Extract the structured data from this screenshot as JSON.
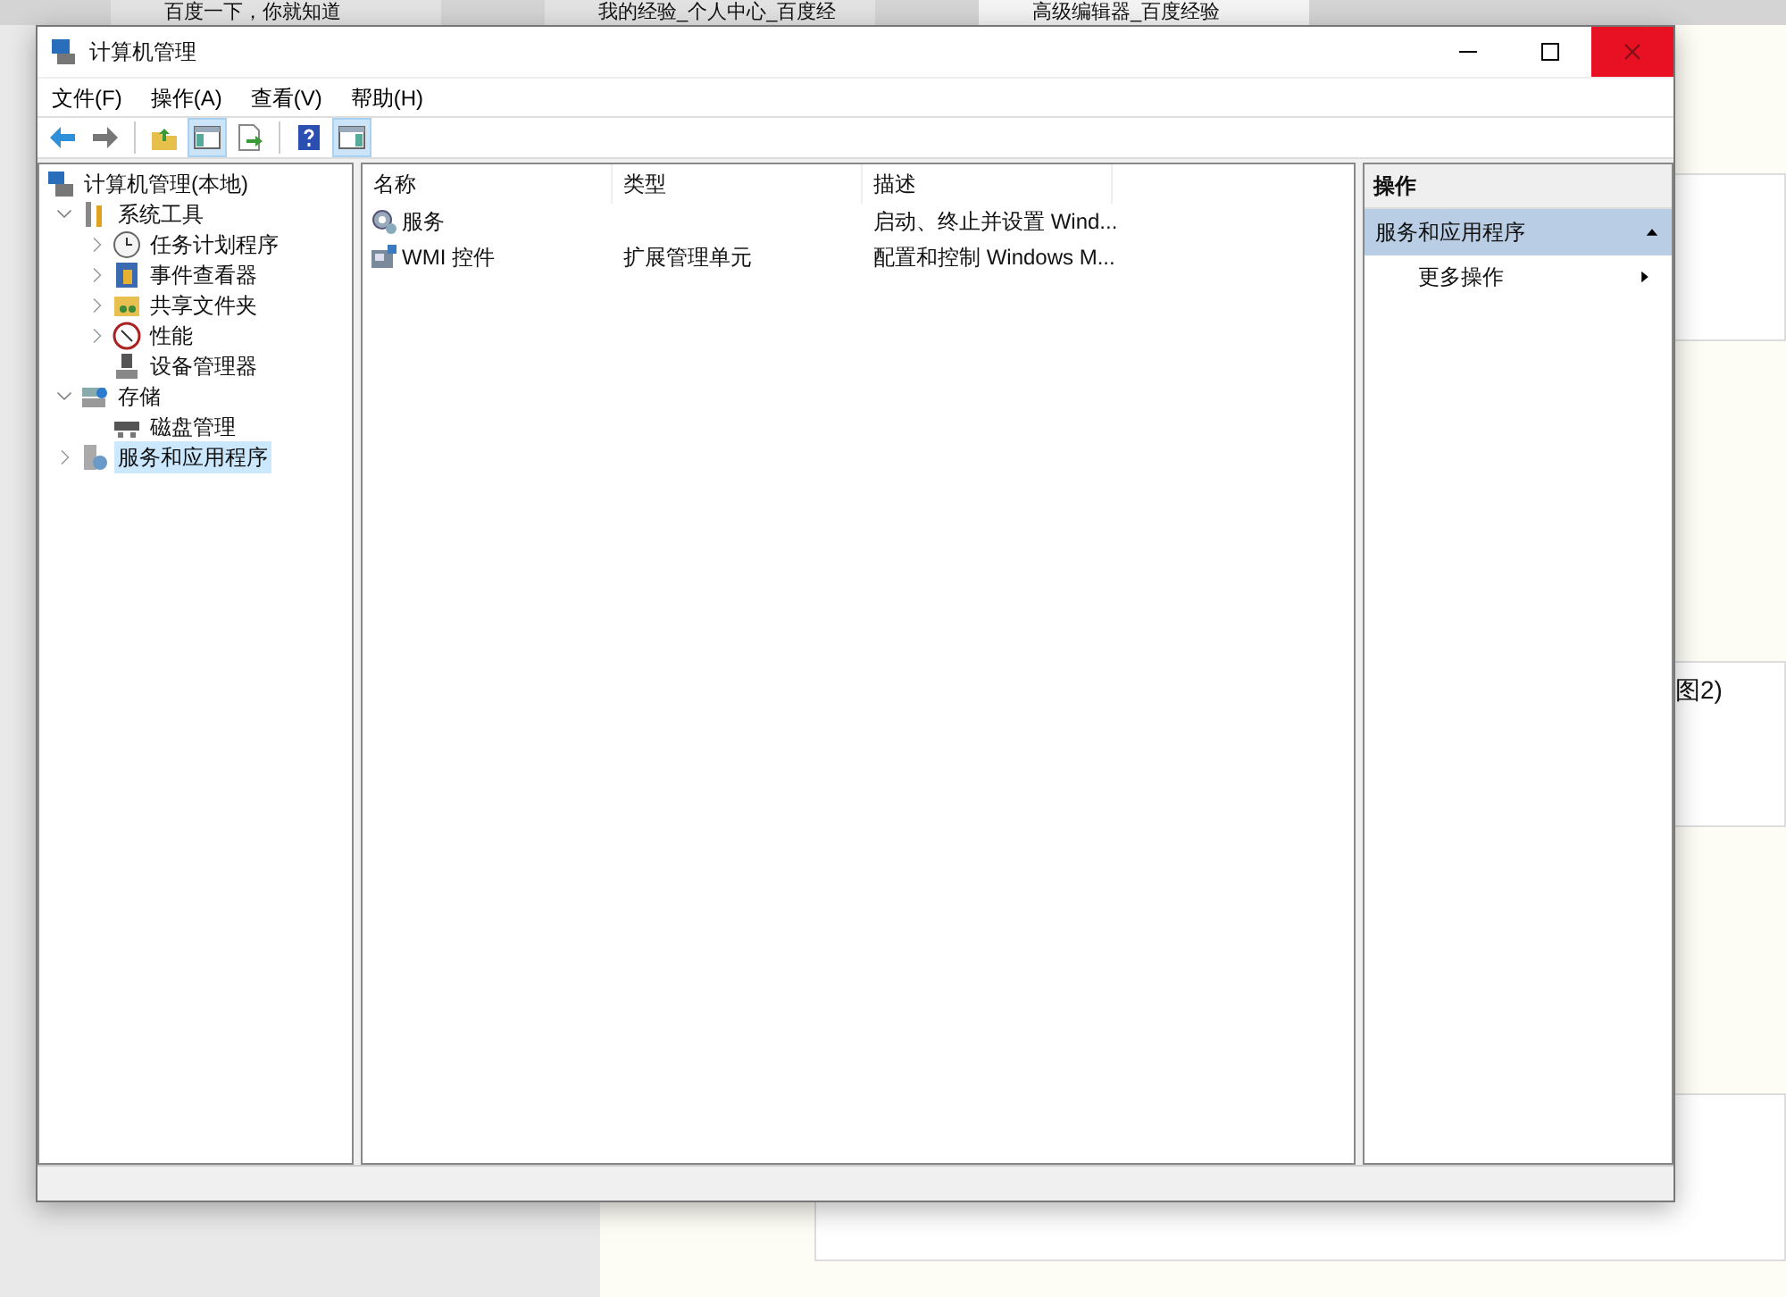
{
  "browser_tabs": [
    {
      "title": "百度一下，你就知道",
      "selected": false
    },
    {
      "title": "我的经验_个人中心_百度经",
      "selected": false
    },
    {
      "title": "高级编辑器_百度经验",
      "selected": true
    }
  ],
  "background_page": {
    "caption": "图2)"
  },
  "window": {
    "title": "计算机管理"
  },
  "menu": [
    "文件(F)",
    "操作(A)",
    "查看(V)",
    "帮助(H)"
  ],
  "toolbar": [
    {
      "kind": "back",
      "selected": false
    },
    {
      "kind": "forward",
      "selected": false
    },
    {
      "kind": "sep"
    },
    {
      "kind": "up",
      "selected": false
    },
    {
      "kind": "tree",
      "selected": true
    },
    {
      "kind": "export",
      "selected": false
    },
    {
      "kind": "sep"
    },
    {
      "kind": "help",
      "selected": false
    },
    {
      "kind": "actionpane",
      "selected": true
    }
  ],
  "tree": [
    {
      "label": "计算机管理(本地)",
      "kind": "computer",
      "selected": false,
      "children": [
        {
          "label": "系统工具",
          "kind": "tools",
          "expanded": true,
          "selected": false,
          "children": [
            {
              "label": "任务计划程序",
              "kind": "clock",
              "expanded": false,
              "selected": false
            },
            {
              "label": "事件查看器",
              "kind": "event",
              "expanded": false,
              "selected": false
            },
            {
              "label": "共享文件夹",
              "kind": "share",
              "expanded": false,
              "selected": false
            },
            {
              "label": "性能",
              "kind": "perf",
              "expanded": false,
              "selected": false
            },
            {
              "label": "设备管理器",
              "kind": "device",
              "selected": false
            }
          ]
        },
        {
          "label": "存储",
          "kind": "storage",
          "expanded": true,
          "selected": false,
          "children": [
            {
              "label": "磁盘管理",
              "kind": "disk",
              "selected": false
            }
          ]
        },
        {
          "label": "服务和应用程序",
          "kind": "services",
          "expanded": false,
          "selected": true
        }
      ]
    }
  ],
  "columns": [
    "名称",
    "类型",
    "描述"
  ],
  "rows": [
    {
      "kind": "gear",
      "name": "服务",
      "description": "启动、终止并设置 Wind..."
    },
    {
      "kind": "wmi",
      "name": "WMI 控件",
      "type": "扩展管理单元",
      "description": "配置和控制 Windows M..."
    }
  ],
  "actions": {
    "header": "操作",
    "section": {
      "title": "服务和应用程序",
      "expanded": true
    },
    "items": [
      {
        "label": "更多操作"
      }
    ]
  }
}
